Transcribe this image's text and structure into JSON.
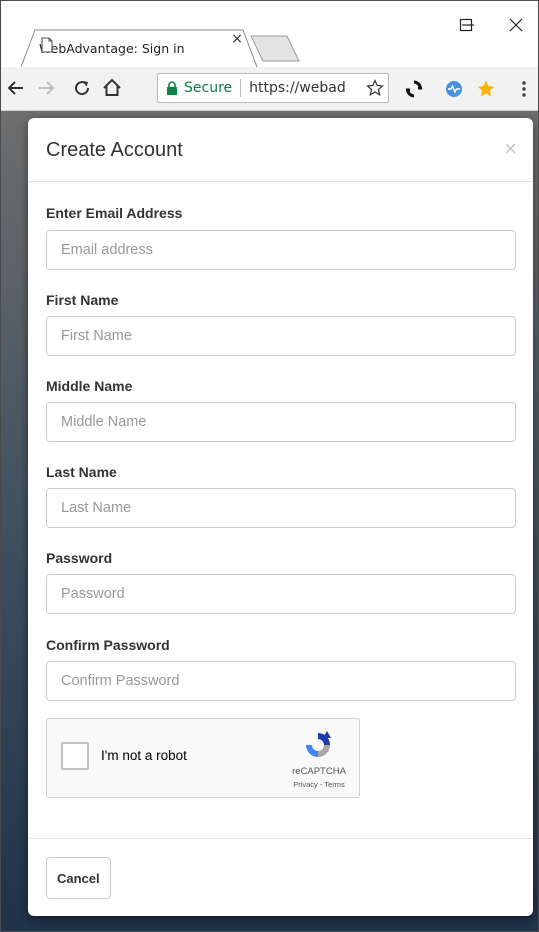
{
  "browser": {
    "tab_title": "WebAdvantage: Sign in",
    "tab_close": "×",
    "secure_label": "Secure",
    "url": "https://webad"
  },
  "modal": {
    "title": "Create Account",
    "close_glyph": "×",
    "fields": [
      {
        "label": "Enter Email Address",
        "placeholder": "Email address"
      },
      {
        "label": "First Name",
        "placeholder": "First Name"
      },
      {
        "label": "Middle Name",
        "placeholder": "Middle Name"
      },
      {
        "label": "Last Name",
        "placeholder": "Last Name"
      },
      {
        "label": "Password",
        "placeholder": "Password"
      },
      {
        "label": "Confirm Password",
        "placeholder": "Confirm Password"
      }
    ],
    "recaptcha": {
      "label": "I'm not a robot",
      "brand": "reCAPTCHA",
      "links": "Privacy - Terms"
    },
    "cancel_label": "Cancel"
  },
  "colors": {
    "secure_green": "#0b8043",
    "backdrop_top": "#6e6e6e",
    "backdrop_bottom": "#1f3349",
    "bookmark_star": "#f4b400",
    "extension_blue": "#4a90e2"
  },
  "icons": [
    "page-icon",
    "close-icon",
    "minimize-icon",
    "maximize-icon",
    "back-arrow-icon",
    "forward-arrow-icon",
    "reload-icon",
    "home-icon",
    "lock-icon",
    "bookmark-star-icon",
    "sync-extension-icon",
    "pulse-extension-icon",
    "star-extension-icon",
    "menu-dots-icon",
    "recaptcha-logo-icon"
  ]
}
